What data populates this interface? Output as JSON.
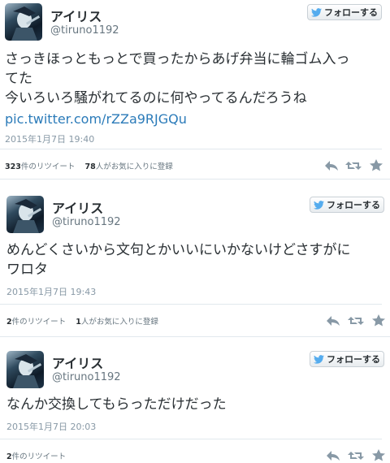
{
  "follow_label": "フォローする",
  "colors": {
    "link": "#2b7bb9",
    "action_icon": "#8899a6",
    "twitter_bird": "#55acee"
  },
  "tweets": [
    {
      "name": "アイリス",
      "handle": "@tiruno1192",
      "text_lines": [
        "さっきほっともっとで買ったからあげ弁当に輪ゴム入っ",
        "てた",
        "今いろいろ騒がれてるのに何やってるんだろうね"
      ],
      "link": "pic.twitter.com/rZZa9RJGQu",
      "timestamp": "2015年1月7日 19:40",
      "retweet_count": "323",
      "retweet_label": "件のリツイート",
      "favorite_count": "78",
      "favorite_label": "人がお気に入りに登録"
    },
    {
      "name": "アイリス",
      "handle": "@tiruno1192",
      "text_lines": [
        "めんどくさいから文句とかいいにいかないけどさすがに",
        "ワロタ"
      ],
      "timestamp": "2015年1月7日 19:43",
      "retweet_count": "2",
      "retweet_label": "件のリツイート",
      "favorite_count": "1",
      "favorite_label": "人がお気に入りに登録"
    },
    {
      "name": "アイリス",
      "handle": "@tiruno1192",
      "text_lines": [
        "なんか交換してもらっただけだった"
      ],
      "timestamp": "2015年1月7日 20:03",
      "retweet_count": "2",
      "retweet_label": "件のリツイート"
    }
  ]
}
